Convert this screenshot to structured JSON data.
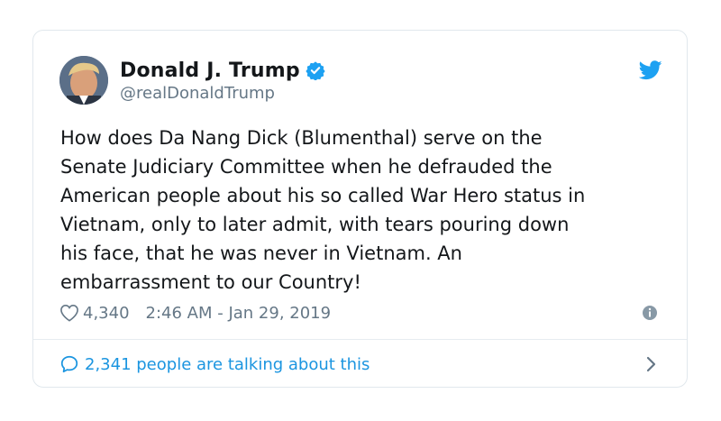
{
  "tweet": {
    "author": {
      "display_name": "Donald J. Trump",
      "handle": "@realDonaldTrump",
      "verified": true
    },
    "text": "How does Da Nang Dick (Blumenthal) serve on the\nSenate Judiciary Committee when he defrauded the\nAmerican people about his so called War Hero status in\nVietnam, only to later admit, with tears pouring down\nhis face, that he was never in Vietnam. An\nembarrassment to our Country!",
    "likes": "4,340",
    "timestamp": "2:46 AM - Jan 29, 2019",
    "talking_about": "2,341 people are talking about this"
  },
  "icons": {
    "brand": "twitter-bird-icon",
    "verified": "verified-badge-icon",
    "like": "heart-icon",
    "info": "info-icon",
    "conversation": "speech-bubble-icon",
    "chevron": "chevron-right-icon"
  },
  "colors": {
    "brand_blue": "#1da1f2",
    "link_blue": "#1b95e0",
    "text": "#14171a",
    "muted": "#657786",
    "border": "#e1e8ed"
  }
}
